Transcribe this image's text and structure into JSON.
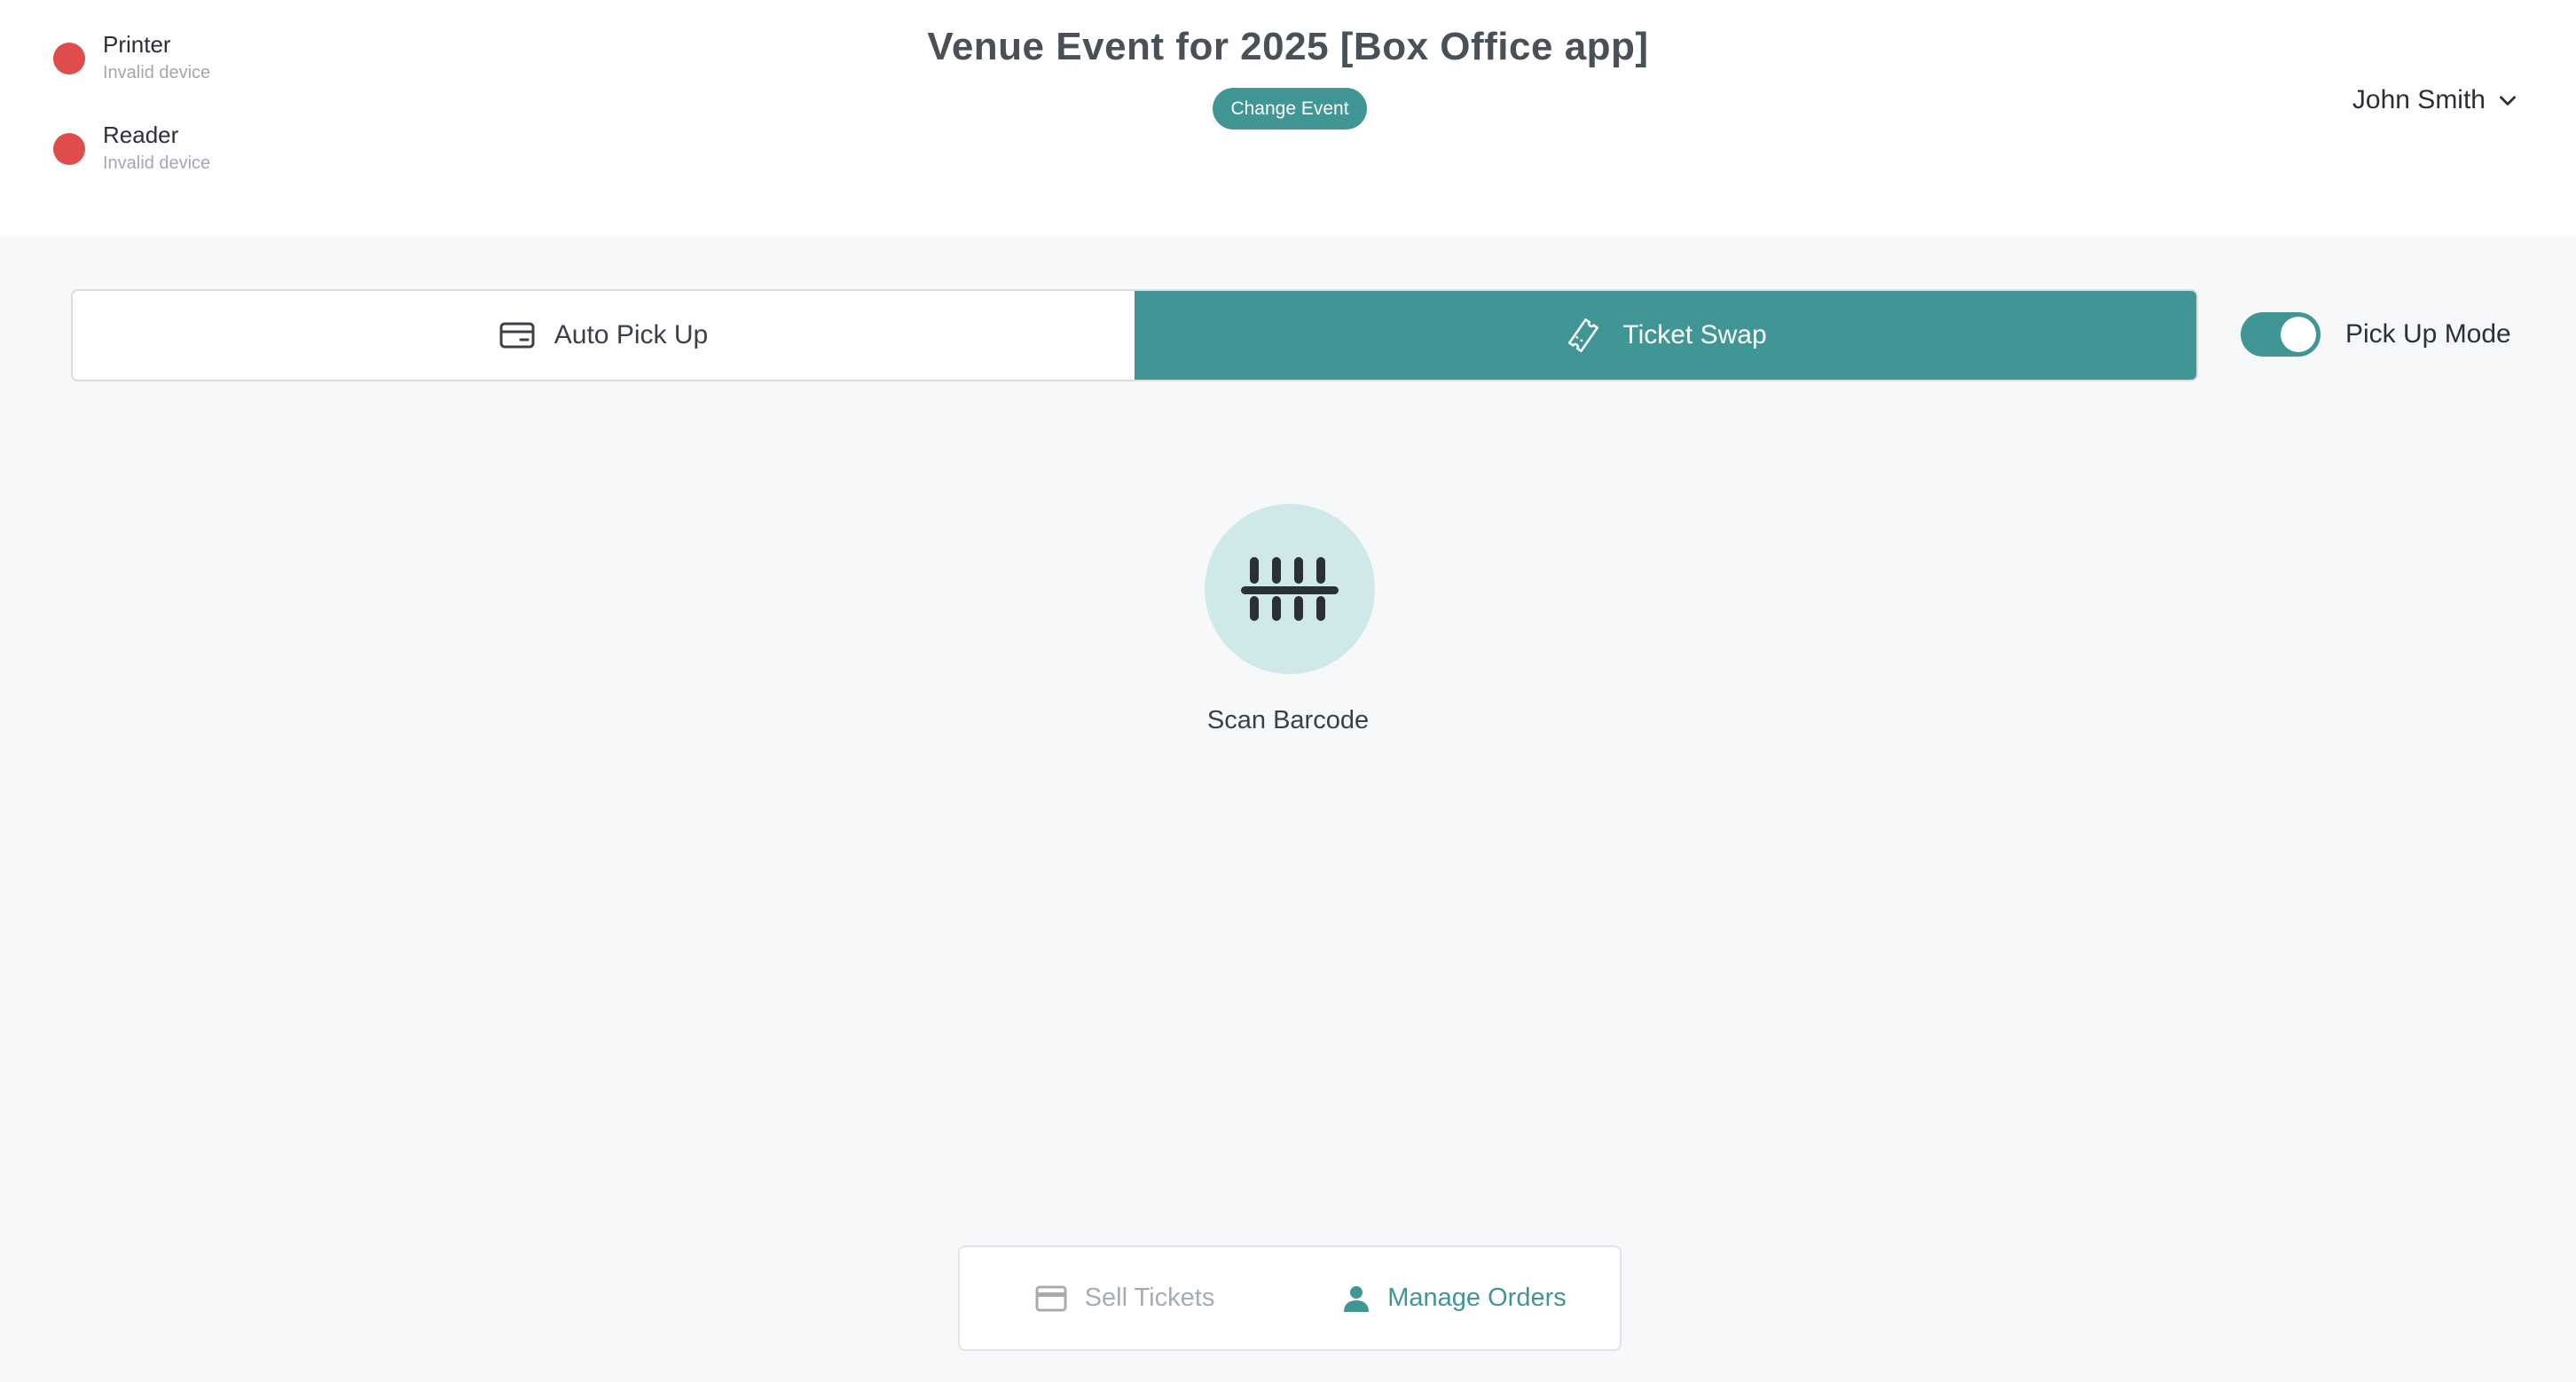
{
  "devices": [
    {
      "name": "Printer",
      "status": "Invalid device",
      "status_color": "#e04b4b"
    },
    {
      "name": "Reader",
      "status": "Invalid device",
      "status_color": "#e04b4b"
    }
  ],
  "header": {
    "title": "Venue Event for 2025 [Box Office app]",
    "change_event_label": "Change Event",
    "user_name": "John Smith"
  },
  "mode_tabs": [
    {
      "label": "Auto Pick Up",
      "icon": "card-icon",
      "active": false
    },
    {
      "label": "Ticket Swap",
      "icon": "ticket-icon",
      "active": true
    }
  ],
  "pickup_mode": {
    "label": "Pick Up Mode",
    "enabled": true
  },
  "scan": {
    "label": "Scan Barcode",
    "icon": "barcode-scan-icon"
  },
  "bottom_nav": {
    "sell_label": "Sell Tickets",
    "manage_label": "Manage Orders",
    "active": "manage"
  },
  "colors": {
    "accent": "#3f9694",
    "accent_light": "#cfe9e8",
    "error": "#e04b4b"
  }
}
